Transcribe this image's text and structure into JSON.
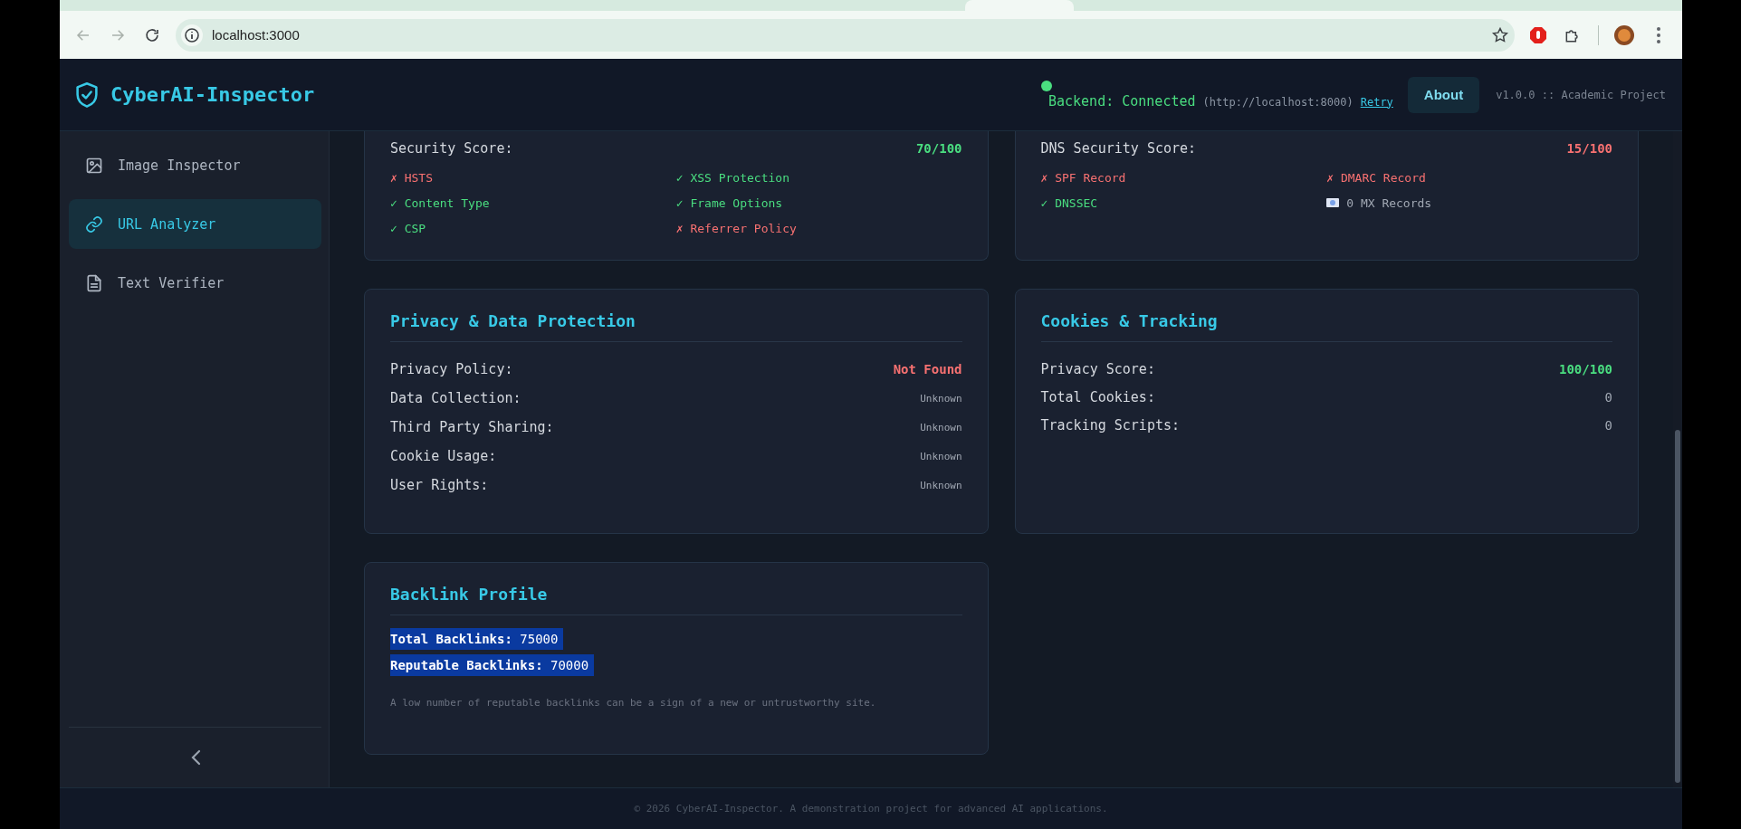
{
  "browser": {
    "url": "localhost:3000"
  },
  "header": {
    "title": "CyberAI-Inspector",
    "backend": {
      "connected": true,
      "label": "Backend: Connected",
      "endpoint": "(http://localhost:8000)",
      "retry": "Retry"
    },
    "about": "About",
    "version": "v1.0.0 :: Academic Project"
  },
  "sidebar": {
    "items": [
      {
        "label": "Image Inspector",
        "kind": "image",
        "selected": false
      },
      {
        "label": "URL Analyzer",
        "kind": "link",
        "selected": true
      },
      {
        "label": "Text Verifier",
        "kind": "document",
        "selected": false
      }
    ]
  },
  "cards": [
    {
      "kind": "checks",
      "score_label": "Security Score:",
      "score": {
        "value": "70/100",
        "kind": "good"
      },
      "checks": [
        {
          "mark": "✗",
          "label": "HSTS",
          "kind": "fail"
        },
        {
          "mark": "✓",
          "label": "XSS Protection",
          "kind": "pass"
        },
        {
          "mark": "✓",
          "label": "Content Type",
          "kind": "pass"
        },
        {
          "mark": "✓",
          "label": "Frame Options",
          "kind": "pass"
        },
        {
          "mark": "✓",
          "label": "CSP",
          "kind": "pass"
        },
        {
          "mark": "✗",
          "label": "Referrer Policy",
          "kind": "fail"
        }
      ]
    },
    {
      "kind": "checks",
      "score_label": "DNS Security Score:",
      "score": {
        "value": "15/100",
        "kind": "bad"
      },
      "checks": [
        {
          "mark": "✗",
          "label": "SPF Record",
          "kind": "fail"
        },
        {
          "mark": "✗",
          "label": "DMARC Record",
          "kind": "fail"
        },
        {
          "mark": "✓",
          "label": "DNSSEC",
          "kind": "pass"
        },
        {
          "label": "0 MX Records",
          "kind": "info"
        }
      ]
    },
    {
      "kind": "table",
      "title": "Privacy & Data Protection",
      "rows": [
        {
          "label": "Privacy Policy:",
          "value": "Not Found",
          "kind": "bad"
        },
        {
          "label": "Data Collection:",
          "value": "Unknown",
          "kind": "unknown"
        },
        {
          "label": "Third Party Sharing:",
          "value": "Unknown",
          "kind": "unknown"
        },
        {
          "label": "Cookie Usage:",
          "value": "Unknown",
          "kind": "unknown"
        },
        {
          "label": "User Rights:",
          "value": "Unknown",
          "kind": "unknown"
        }
      ]
    },
    {
      "kind": "table",
      "title": "Cookies & Tracking",
      "rows": [
        {
          "label": "Privacy Score:",
          "value": "100/100",
          "kind": "good"
        },
        {
          "label": "Total Cookies:",
          "value": "0",
          "kind": "plain"
        },
        {
          "label": "Tracking Scripts:",
          "value": "0",
          "kind": "plain"
        }
      ]
    },
    {
      "kind": "lines",
      "title": "Backlink Profile",
      "lines": [
        {
          "text": "**Total Backlinks:** 75000 ",
          "highlighted": true
        },
        {
          "text": "**Reputable Backlinks:** 70000",
          "highlighted": true
        }
      ],
      "note": "A low number of reputable backlinks can be a sign of a new or untrustworthy site."
    }
  ],
  "footer": "© 2026 CyberAI-Inspector. A demonstration project for advanced AI applications."
}
